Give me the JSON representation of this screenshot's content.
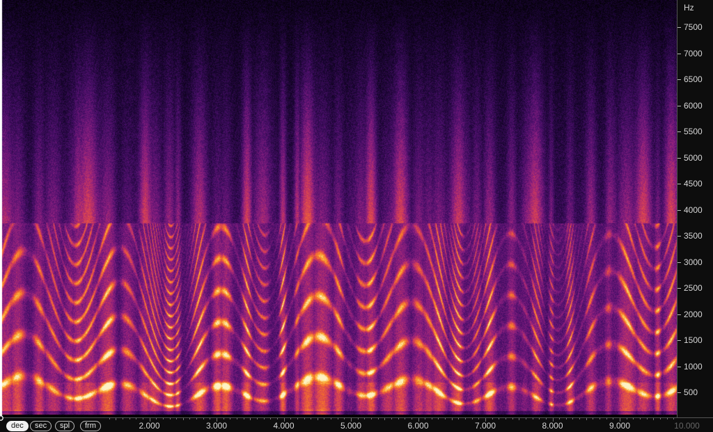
{
  "spectrogram": {
    "colormap": [
      "#000000",
      "#1a0533",
      "#4a0f6b",
      "#8c1f80",
      "#d13a5c",
      "#f4702c",
      "#fbb63a",
      "#fdf2c4"
    ],
    "background_color": "#000000"
  },
  "frequency_axis": {
    "unit": "Hz",
    "ticks": [
      "7500",
      "7000",
      "6500",
      "6000",
      "5500",
      "5000",
      "4500",
      "4000",
      "3500",
      "3000",
      "2500",
      "2000",
      "1500",
      "1000",
      "500"
    ]
  },
  "time_axis": {
    "ticks": [
      "2.000",
      "3.000",
      "4.000",
      "5.000",
      "6.000",
      "7.000",
      "8.000",
      "9.000"
    ],
    "end_label": "10.000"
  },
  "unit_buttons": [
    {
      "label": "dec",
      "active": true
    },
    {
      "label": "sec",
      "active": false
    },
    {
      "label": "spl",
      "active": false
    },
    {
      "label": "frm",
      "active": false
    }
  ],
  "playhead": {
    "icon": "playhead-marker-icon"
  }
}
